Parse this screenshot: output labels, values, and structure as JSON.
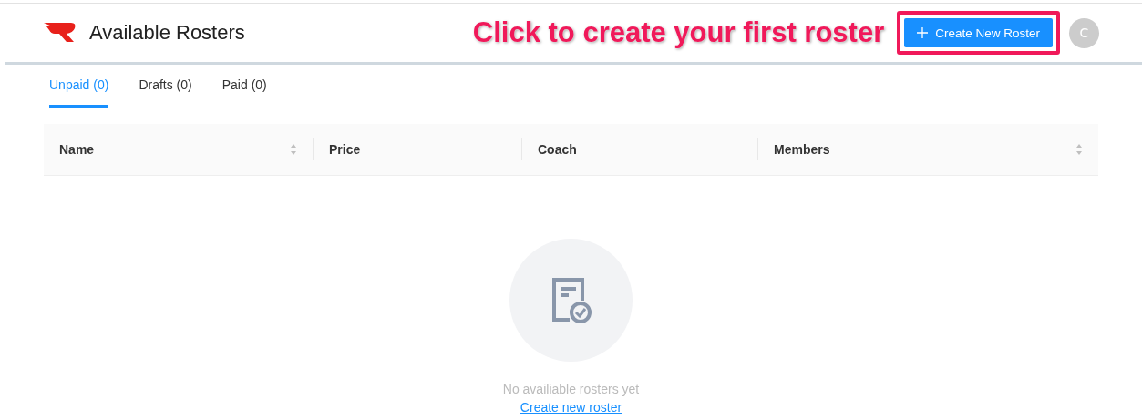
{
  "header": {
    "title": "Available Rosters",
    "callout": "Click to create your first roster",
    "create_button": "Create New Roster",
    "avatar": "C"
  },
  "tabs": [
    {
      "label": "Unpaid (0)",
      "selected": true
    },
    {
      "label": "Drafts (0)",
      "selected": false
    },
    {
      "label": "Paid (0)",
      "selected": false
    }
  ],
  "table": {
    "columns": [
      {
        "label": "Name",
        "sortable": true
      },
      {
        "label": "Price",
        "sortable": false
      },
      {
        "label": "Coach",
        "sortable": false
      },
      {
        "label": "Members",
        "sortable": true
      }
    ]
  },
  "empty_state": {
    "message": "No availiable rosters yet",
    "link": "Create new roster"
  }
}
